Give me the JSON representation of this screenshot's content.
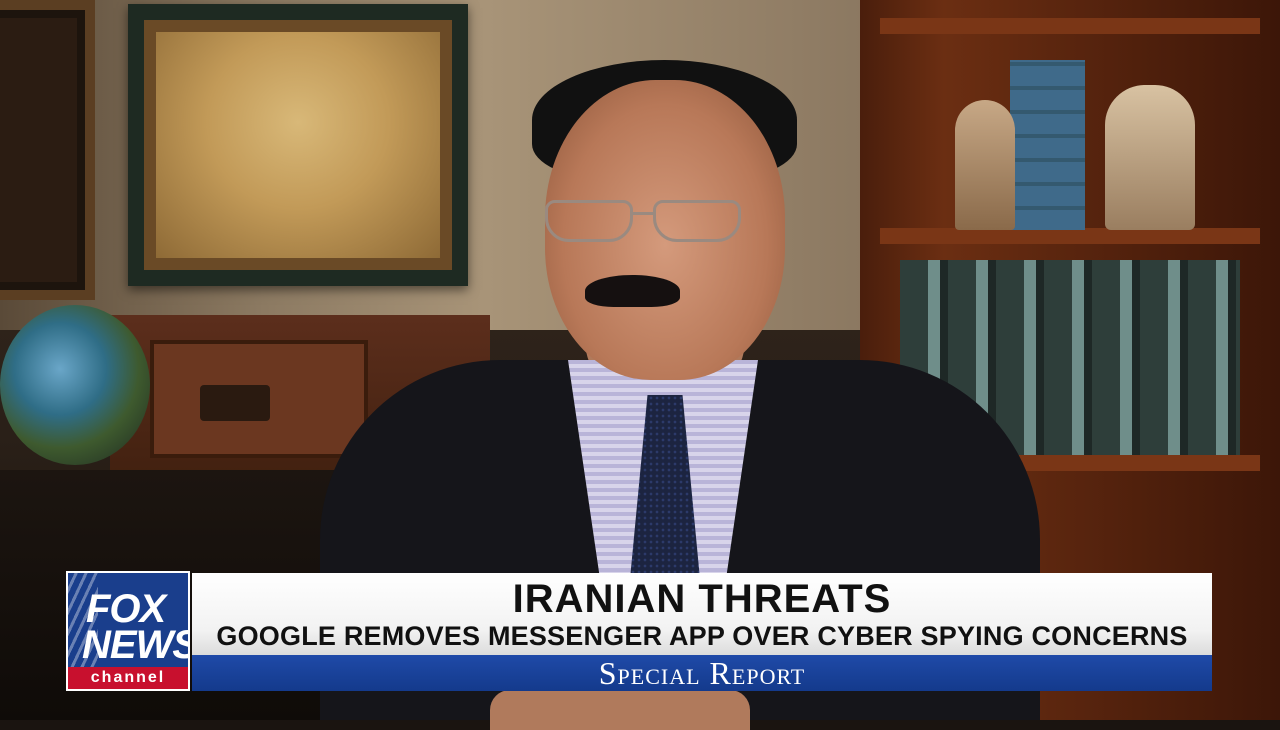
{
  "lower_third": {
    "logo": {
      "line1": "FOX",
      "line2": "NEWS",
      "sub": "channel"
    },
    "headline": "IRANIAN THREATS",
    "subheadline": "GOOGLE REMOVES MESSENGER APP OVER CYBER SPYING CONCERNS",
    "show_name": "Special Report"
  },
  "colors": {
    "banner_blue": "#143a8c",
    "logo_red": "#c8102e",
    "banner_white": "#ffffff"
  }
}
